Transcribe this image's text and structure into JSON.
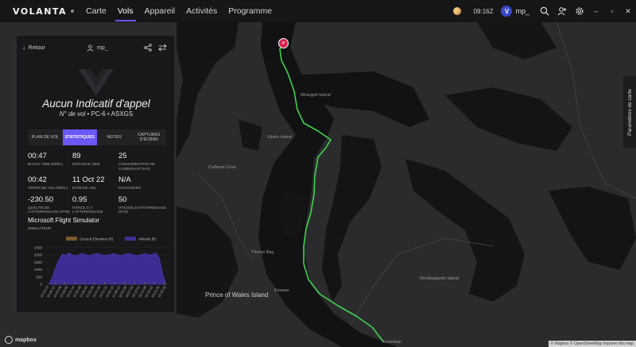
{
  "app": {
    "brand": "VOLANTA"
  },
  "nav": {
    "tabs": [
      "Carte",
      "Vols",
      "Appareil",
      "Activités",
      "Programme"
    ],
    "active": "Vols"
  },
  "topbar": {
    "time": "09:16Z",
    "avatar_letter": "V",
    "username": "mp_"
  },
  "map": {
    "settings_tab": "Paramètres de carte",
    "labels": {
      "wrangell": "Wrangell Island",
      "etolin": "Etolin Island",
      "prince_of_wales": "Prince of Wales Island",
      "revillagigedo": "Revillagigedo Island",
      "ketchikan": "Ketchikan",
      "kasaan": "Kasaan",
      "thorne": "Thorne Bay",
      "coffman": "Coffman Cove"
    },
    "mapbox_logo": "mapbox",
    "attribution": "© Mapbox © OpenStreetMap  Improve this map"
  },
  "panel": {
    "back": "Retour",
    "user": "mp_",
    "callsign": "Aucun Indicatif d'appel",
    "flight_prefix": "N° de vol",
    "aircraft": "PC-6",
    "registration": "ASXGS",
    "tabs": [
      "PLAN DE VOL",
      "STATISTIQUES",
      "NOTES",
      "CAPTURES D'ÉCRAN"
    ],
    "active_tab": "STATISTIQUES",
    "stats": [
      {
        "value": "00:47",
        "label": "BLOCK TIME (RÉEL)"
      },
      {
        "value": "89",
        "label": "DISTANCE (NM)"
      },
      {
        "value": "25",
        "label": "CONSOMMATION DE CARBURANT (KG)"
      },
      {
        "value": "00:42",
        "label": "TEMPS DE VOL (RÉEL)"
      },
      {
        "value": "11 Oct 22",
        "label": "DATE DE VOL"
      },
      {
        "value": "N/A",
        "label": "PASSAGERS"
      },
      {
        "value": "-230.50",
        "label": "QUALITÉ DE L'ATTERRISSAGE (FPM)"
      },
      {
        "value": "0.95",
        "label": "FORCE G À L'ATTERRISSAGE"
      },
      {
        "value": "50",
        "label": "VITESSE D'ATTERRISSAGE (KTS)"
      }
    ],
    "simulator": "Microsoft Flight Simulator",
    "simulator_label": "SIMULATEUR"
  },
  "colors": {
    "accent": "#6b57f5",
    "route": "#3dd44a",
    "origin": "#d4254f"
  },
  "chart_data": {
    "type": "area",
    "series": [
      {
        "name": "Ground Elevation (ft)",
        "color": "#7a5a2a",
        "values": [
          0,
          0,
          0,
          0,
          0,
          0,
          0,
          0,
          0,
          0,
          0,
          0,
          0,
          0,
          0,
          0,
          0,
          0,
          0,
          0,
          0,
          0,
          0,
          0,
          0,
          0,
          0,
          0,
          0,
          0,
          0,
          0,
          0,
          0,
          0
        ]
      },
      {
        "name": "Altitude (ft)",
        "color": "#3d2f9a",
        "values": [
          0,
          400,
          1100,
          1700,
          2050,
          2000,
          2150,
          2000,
          1950,
          2050,
          2100,
          2000,
          1950,
          2050,
          2100,
          2050,
          1950,
          2000,
          2050,
          2100,
          2000,
          1950,
          2050,
          2100,
          2050,
          2000,
          1950,
          2050,
          2100,
          2000,
          2050,
          2150,
          1800,
          700,
          0
        ]
      }
    ],
    "yticks": [
      0,
      500,
      1000,
      1500,
      2000,
      2500
    ],
    "ylim": [
      0,
      2600
    ],
    "xticks": [
      "15:16:18",
      "15:20:12",
      "15:24:06",
      "15:28:00",
      "15:31:54",
      "15:35:48",
      "15:39:42",
      "15:43:36",
      "15:47:30",
      "15:51:24",
      "15:55:18",
      "15:59:12",
      "16:03:06",
      "16:07:00",
      "16:10:54",
      "16:14:48",
      "16:18:42",
      "16:22:36",
      "16:26:30"
    ],
    "legend_position": "top"
  }
}
